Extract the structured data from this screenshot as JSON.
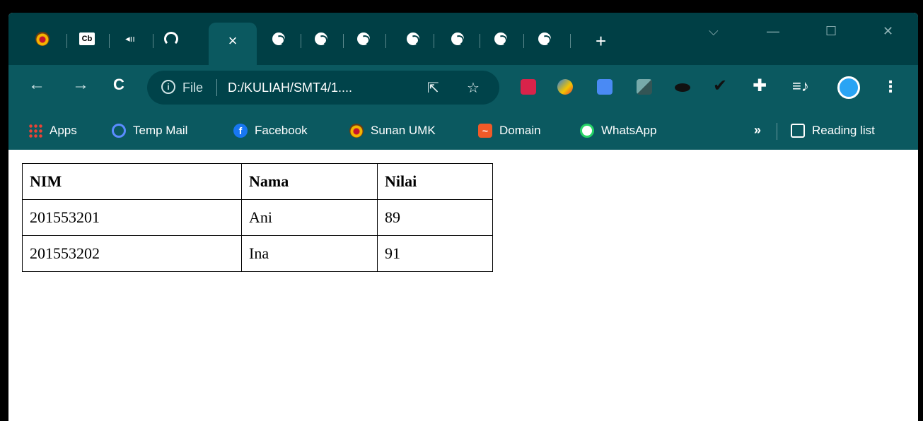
{
  "browser": {
    "tabs": [
      {
        "kind": "favicon",
        "icon": "umk-logo-icon"
      },
      {
        "kind": "favicon",
        "icon": "cb-icon",
        "text": "Cb"
      },
      {
        "kind": "audio",
        "icon": "speaker-icon"
      },
      {
        "kind": "favicon",
        "icon": "github-icon"
      },
      {
        "kind": "active",
        "icon": "close-icon",
        "close": "×"
      },
      {
        "kind": "globe",
        "icon": "globe-icon"
      },
      {
        "kind": "globe",
        "icon": "globe-icon"
      },
      {
        "kind": "globe",
        "icon": "globe-icon"
      },
      {
        "kind": "globe",
        "icon": "globe-icon"
      },
      {
        "kind": "globe",
        "icon": "globe-icon"
      },
      {
        "kind": "globe",
        "icon": "globe-icon"
      },
      {
        "kind": "globe",
        "icon": "globe-icon"
      }
    ],
    "new_tab": "+",
    "window_controls": {
      "dropdown": "⌵",
      "minimize": "—",
      "maximize": "☐",
      "close": "✕"
    },
    "nav": {
      "back": "←",
      "forward": "→",
      "reload": "C"
    },
    "address": {
      "info": "i",
      "scheme": "File",
      "url": "D:/KULIAH/SMT4/1....",
      "share_icon": "share-icon",
      "bookmark_star": "☆"
    },
    "menu": "⋮",
    "bookmarks": [
      {
        "label": "Apps",
        "icon": "apps-grid-icon"
      },
      {
        "label": "Temp Mail",
        "icon": "temp-mail-icon"
      },
      {
        "label": "Facebook",
        "icon": "facebook-icon",
        "glyph": "f"
      },
      {
        "label": "Sunan UMK",
        "icon": "umk-logo-icon"
      },
      {
        "label": "Domain",
        "icon": "domain-icon",
        "glyph": "~"
      },
      {
        "label": "WhatsApp",
        "icon": "whatsapp-icon"
      }
    ],
    "bookmarks_more": "»",
    "reading_list": "Reading list"
  },
  "colors": {
    "titlebar": "#003f45",
    "toolbar": "#0b5960",
    "omnibox": "#00434a"
  },
  "table": {
    "headers": [
      "NIM",
      "Nama",
      "Nilai"
    ],
    "rows": [
      [
        "201553201",
        "Ani",
        "89"
      ],
      [
        "201553202",
        "Ina",
        "91"
      ]
    ]
  }
}
